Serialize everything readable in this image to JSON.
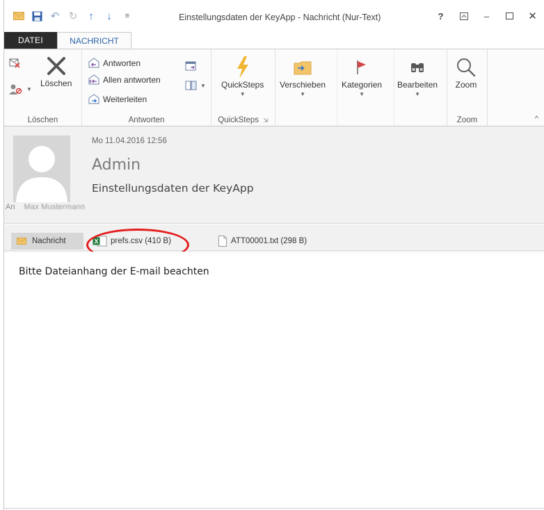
{
  "window": {
    "title": "Einstellungsdaten der KeyApp - Nachricht (Nur-Text)",
    "help_label": "?",
    "accent_color": "#2a63a8"
  },
  "quick_access": {
    "icons": [
      "mail-icon",
      "save-icon",
      "undo-icon",
      "redo-icon",
      "arrow-up-icon",
      "arrow-down-icon",
      "customize-icon"
    ]
  },
  "tabs": [
    {
      "label": "DATEI",
      "active": false
    },
    {
      "label": "NACHRICHT",
      "active": true
    }
  ],
  "ribbon": {
    "groups": {
      "loeschen": {
        "label": "Löschen",
        "delete_label": "Löschen"
      },
      "antworten": {
        "label": "Antworten",
        "reply_label": "Antworten",
        "reply_all_label": "Allen antworten",
        "forward_label": "Weiterleiten"
      },
      "quicksteps": {
        "label": "QuickSteps",
        "button_label": "QuickSteps"
      },
      "move": {
        "button_label": "Verschieben"
      },
      "tags": {
        "button_label": "Kategorien"
      },
      "editing": {
        "button_label": "Bearbeiten"
      },
      "zoom": {
        "label": "Zoom",
        "button_label": "Zoom"
      }
    }
  },
  "message": {
    "date": "Mo 11.04.2016 12:56",
    "sender": "Admin",
    "subject": "Einstellungsdaten der KeyApp",
    "to_label": "An",
    "to_name": "Max Mustermann"
  },
  "attachments": {
    "message_tab_label": "Nachricht",
    "items": [
      {
        "name": "prefs.csv (410 B)",
        "icon": "excel-file-icon"
      },
      {
        "name": "ATT00001.txt (298 B)",
        "icon": "text-file-icon"
      }
    ],
    "highlight_color": "#e51c1c"
  },
  "body": {
    "text": "Bitte Dateianhang der E-mail beachten"
  }
}
